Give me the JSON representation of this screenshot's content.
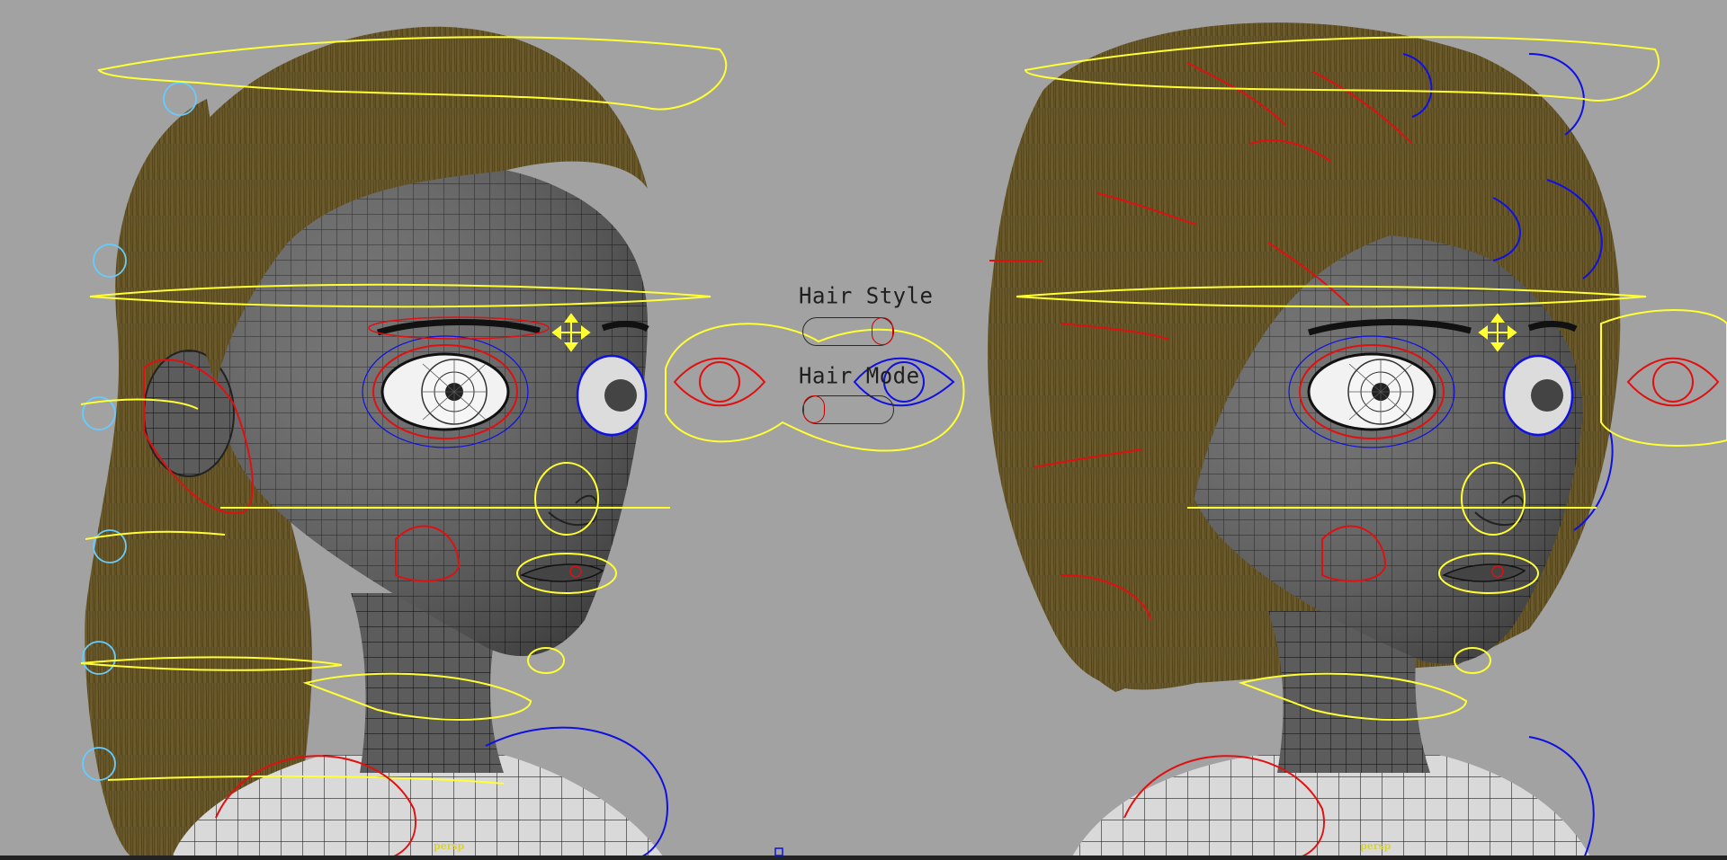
{
  "controls": {
    "hair_style_label": "Hair Style",
    "hair_mode_label": "Hair Mode"
  },
  "viewports": {
    "left_camera_label": "persp",
    "right_camera_label": "persp"
  },
  "colors": {
    "background": "#a2a2a2",
    "hair": "#6b5a2c",
    "mesh": "#5a5a5a",
    "wire": "#161616",
    "ctrl_yellow": "#ffff33",
    "ctrl_red": "#e01010",
    "ctrl_blue": "#1010e0",
    "ctrl_cyan": "#66ccff"
  },
  "icons": [
    "move-manipulator-icon",
    "eye-control-icon"
  ]
}
